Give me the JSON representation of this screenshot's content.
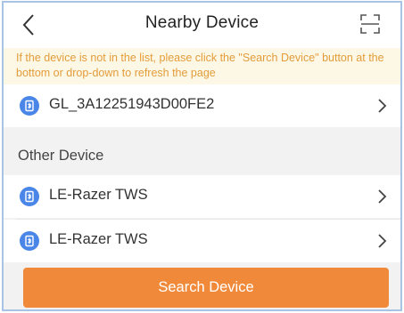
{
  "header": {
    "title": "Nearby Device",
    "back_icon": "chevron-left-icon",
    "scan_icon": "scan-icon"
  },
  "notice": {
    "text": "If the device is not in the list, please click the \"Search Device\" button at the bottom or drop-down to refresh the page"
  },
  "paired_devices": [
    {
      "name": "GL_3A12251943D00FE2",
      "icon": "device-icon"
    }
  ],
  "other_section": {
    "label": "Other Device"
  },
  "other_devices": [
    {
      "name": "LE-Razer TWS",
      "icon": "device-icon"
    },
    {
      "name": "LE-Razer TWS",
      "icon": "device-icon"
    }
  ],
  "search_button": {
    "label": "Search Device"
  },
  "colors": {
    "accent": "#f08a3a",
    "notice_text": "#e39c3a",
    "notice_bg": "#fdf8e6",
    "device_icon": "#4a86e8",
    "frame_border": "#a9c3e4"
  }
}
